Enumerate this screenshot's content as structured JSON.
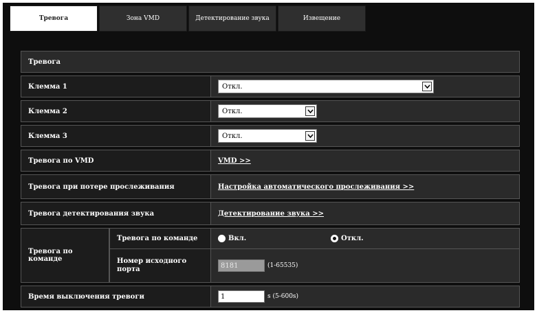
{
  "tabs": [
    {
      "label": "Тревога",
      "active": true
    },
    {
      "label": "Зона VMD",
      "active": false
    },
    {
      "label": "Детектирование звука",
      "active": false
    },
    {
      "label": "Извещение",
      "active": false
    }
  ],
  "section": {
    "title": "Тревога"
  },
  "rows": {
    "channel1": {
      "label": "Клемма 1",
      "value": "Откл."
    },
    "channel2": {
      "label": "Клемма 2",
      "value": "Откл."
    },
    "channel3": {
      "label": "Клемма 3",
      "value": "Откл."
    },
    "vmd": {
      "label": "Тревога по VMD",
      "link": "VMD >>"
    },
    "tracking": {
      "label": "Тревога при потере прослеживания",
      "link": "Настройка автоматического прослеживания >>"
    },
    "audio": {
      "label": "Тревога детектирования звука",
      "link": "Детектирование звука >>"
    },
    "command": {
      "label": "Тревога по команде",
      "sub_command_label": "Тревога по команде",
      "radio_on": "Вкл.",
      "radio_off": "Откл.",
      "selected": "off",
      "sub_port_label": "Номер исходного порта",
      "port_value": "8181",
      "port_hint": "(1-65535)"
    },
    "deactivation": {
      "label": "Время выключения тревоги",
      "value": "1",
      "hint": "s (5-600s)"
    }
  }
}
